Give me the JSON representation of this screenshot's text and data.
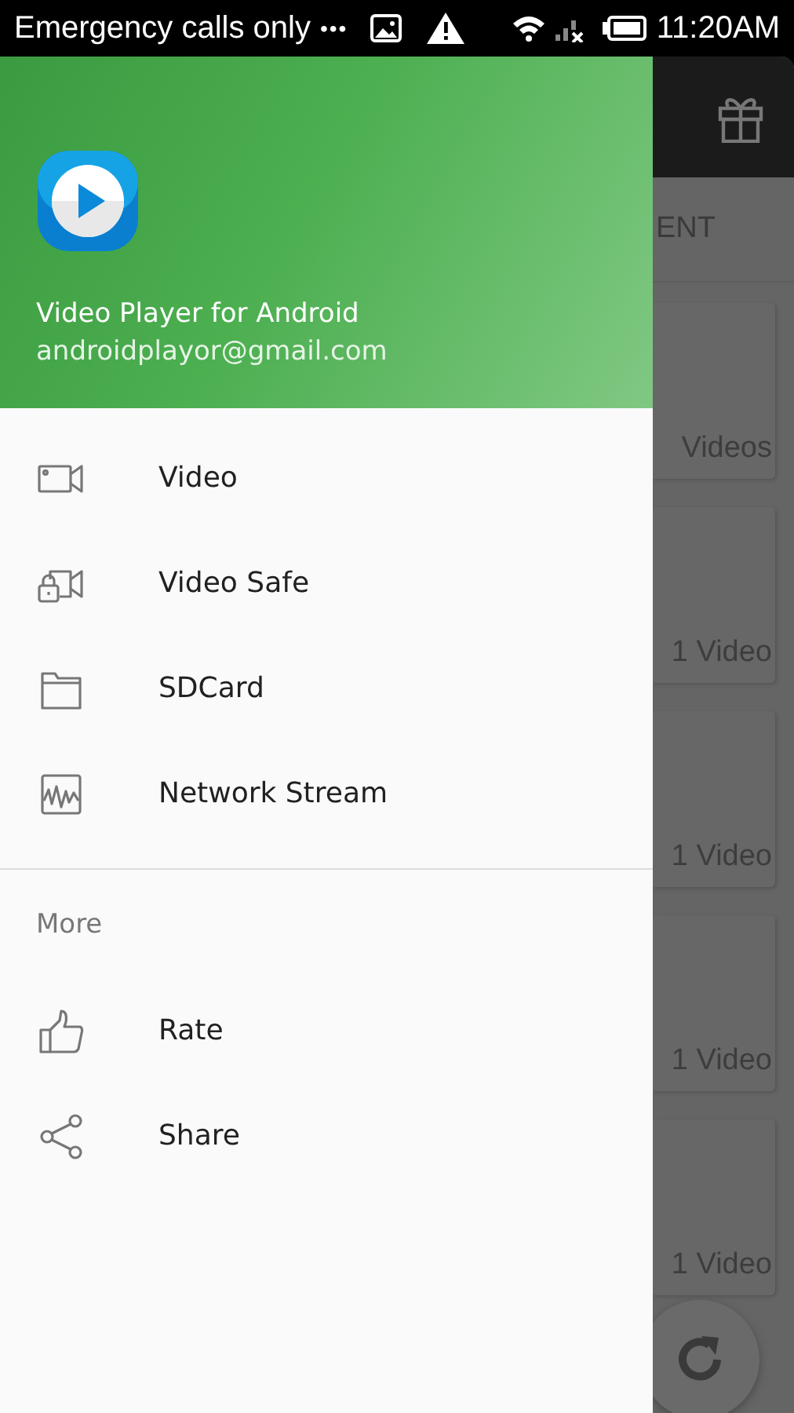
{
  "status_bar": {
    "carrier": "Emergency calls only",
    "dots": "•••",
    "time": "11:20AM"
  },
  "drawer": {
    "app_name": "Video Player for Android",
    "email": "androidplayor@gmail.com",
    "items": [
      {
        "kind": "video",
        "label": "Video"
      },
      {
        "kind": "safe",
        "label": "Video Safe"
      },
      {
        "kind": "folder",
        "label": "SDCard"
      },
      {
        "kind": "stream",
        "label": "Network Stream"
      }
    ],
    "section": "More",
    "more_items": [
      {
        "kind": "rate",
        "label": "Rate"
      },
      {
        "kind": "share",
        "label": "Share"
      }
    ]
  },
  "background": {
    "tab": "ENT",
    "cards": [
      {
        "count": "Videos"
      },
      {
        "count": "1 Video"
      },
      {
        "count": "1 Video"
      },
      {
        "count": "1 Video"
      },
      {
        "count": "1 Video"
      }
    ]
  }
}
